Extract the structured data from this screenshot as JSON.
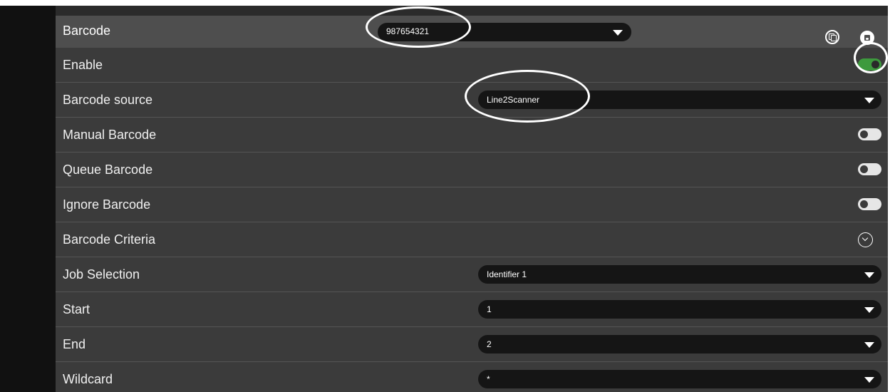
{
  "header": {
    "title": "Barcode",
    "selected_barcode": "987654321",
    "copy_icon": "copy-icon",
    "save_icon": "save-icon"
  },
  "rows": [
    {
      "label": "Enable",
      "control": "toggle",
      "state": "on"
    },
    {
      "label": "Barcode source",
      "control": "select",
      "value": "Line2Scanner"
    },
    {
      "label": "Manual Barcode",
      "control": "toggle",
      "state": "off"
    },
    {
      "label": "Queue Barcode",
      "control": "toggle",
      "state": "off"
    },
    {
      "label": "Ignore Barcode",
      "control": "toggle",
      "state": "off"
    },
    {
      "label": "Barcode Criteria",
      "control": "expand",
      "icon": "chevron-down-icon"
    },
    {
      "label": "Job Selection",
      "control": "select",
      "value": "Identifier 1"
    },
    {
      "label": "Start",
      "control": "select",
      "value": "1"
    },
    {
      "label": "End",
      "control": "select",
      "value": "2"
    },
    {
      "label": "Wildcard",
      "control": "select",
      "value": "*"
    }
  ],
  "colors": {
    "panel_bg": "#3b3b3b",
    "header_bg": "#4e4e4e",
    "input_bg": "#151515",
    "toggle_on": "#3d9a3d",
    "annotation": "#ffffff"
  }
}
